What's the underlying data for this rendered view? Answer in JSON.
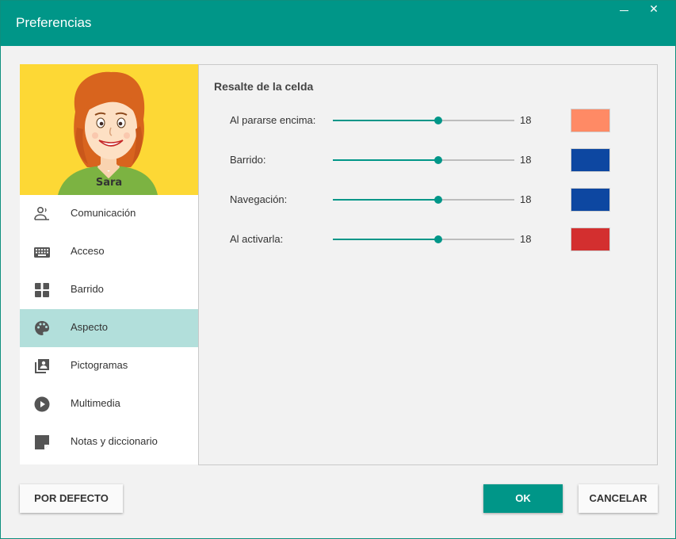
{
  "window": {
    "title": "Preferencias",
    "minimize_icon": "minimize-icon",
    "close_icon": "close-icon",
    "close_glyph": "✕"
  },
  "profile": {
    "name": "Sara"
  },
  "menu": {
    "items": [
      {
        "label": "Comunicación",
        "icon": "person-speaking-icon"
      },
      {
        "label": "Acceso",
        "icon": "keyboard-icon"
      },
      {
        "label": "Barrido",
        "icon": "scan-grid-icon"
      },
      {
        "label": "Aspecto",
        "icon": "palette-icon",
        "active": true
      },
      {
        "label": "Pictogramas",
        "icon": "image-library-icon"
      },
      {
        "label": "Multimedia",
        "icon": "play-circle-icon"
      },
      {
        "label": "Notas y diccionario",
        "icon": "note-icon"
      }
    ]
  },
  "highlight": {
    "title": "Resalte de la celda",
    "rows": [
      {
        "label": "Al pararse encima:",
        "value": "18",
        "fraction": 0.58,
        "color": "#ff8a65"
      },
      {
        "label": "Barrido:",
        "value": "18",
        "fraction": 0.58,
        "color": "#0d47a1"
      },
      {
        "label": "Navegación:",
        "value": "18",
        "fraction": 0.58,
        "color": "#0d47a1"
      },
      {
        "label": "Al activarla:",
        "value": "18",
        "fraction": 0.58,
        "color": "#d32f2f"
      }
    ]
  },
  "buttons": {
    "default_label": "POR DEFECTO",
    "ok_label": "OK",
    "cancel_label": "CANCELAR"
  },
  "colors": {
    "accent": "#009688",
    "active_item": "#b2dfdb",
    "avatar_bg": "#fdd835"
  }
}
